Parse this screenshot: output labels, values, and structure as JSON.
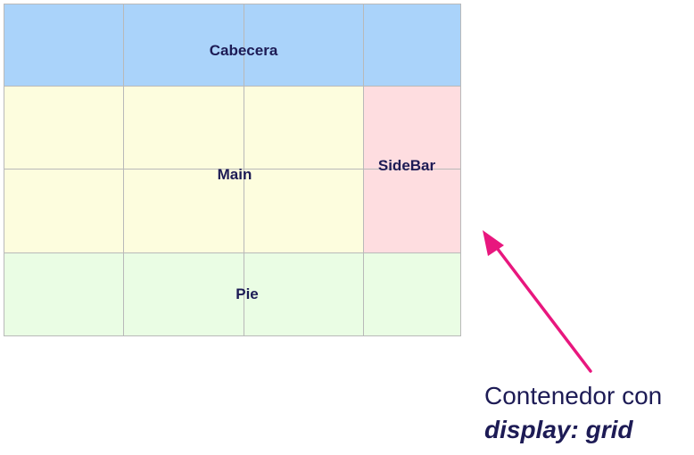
{
  "grid": {
    "areas": {
      "header": "Cabecera",
      "main": "Main",
      "sidebar": "SideBar",
      "footer": "Pie"
    },
    "colors": {
      "header": "#aad3fa",
      "main": "#fdfdde",
      "sidebar": "#fedde0",
      "footer": "#eafde4",
      "gridline": "#b9b9b9",
      "text": "#1d1b55"
    }
  },
  "annotation": {
    "line1": "Contenedor con",
    "line2": "display: grid",
    "arrow_color": "#e8177e"
  }
}
